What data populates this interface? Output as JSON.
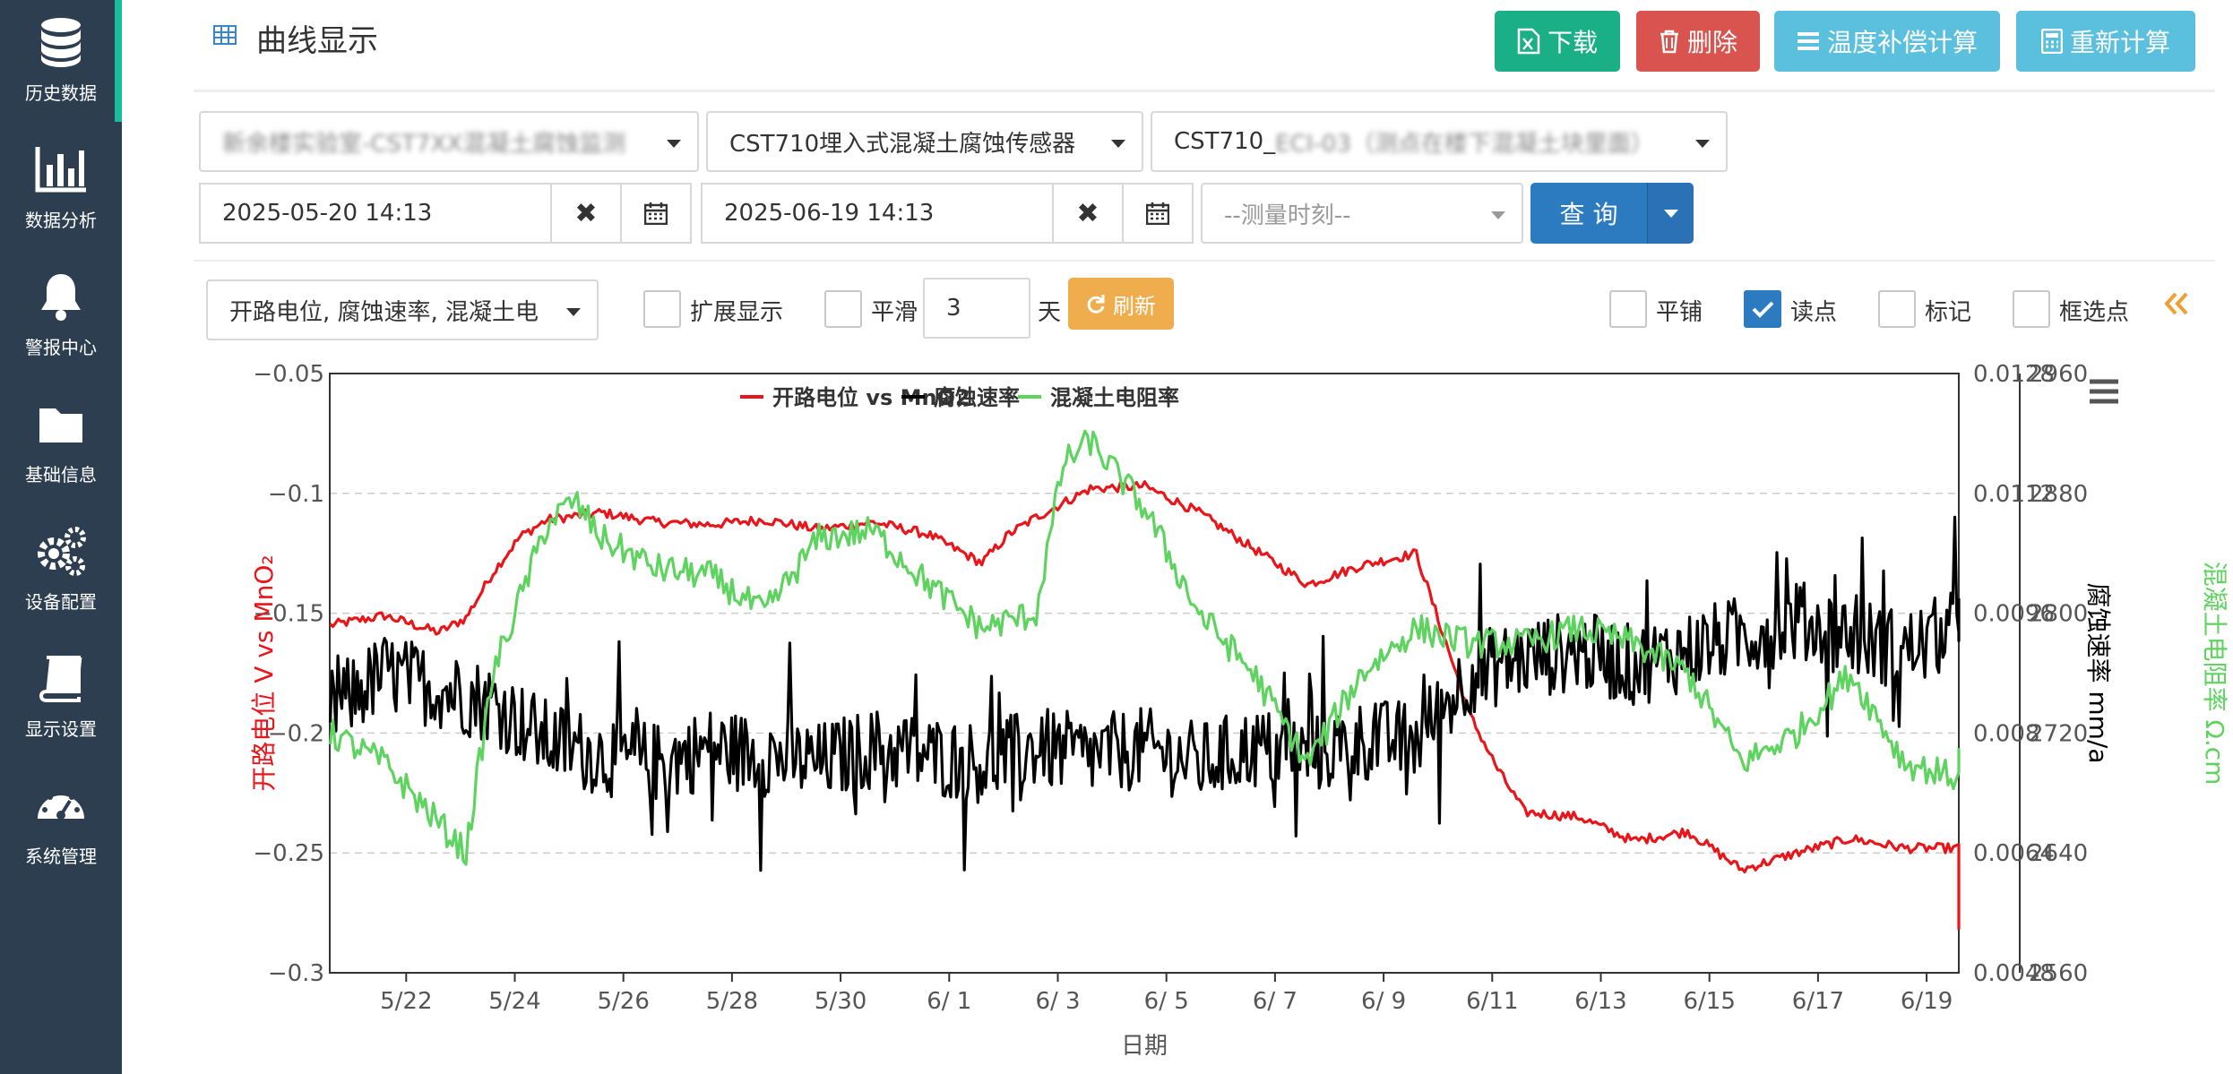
{
  "sidebar": {
    "items": [
      {
        "label": "历史数据",
        "icon": "database-icon",
        "active": true
      },
      {
        "label": "数据分析",
        "icon": "bar-chart-icon",
        "active": false
      },
      {
        "label": "警报中心",
        "icon": "bell-icon",
        "active": false
      },
      {
        "label": "基础信息",
        "icon": "folder-icon",
        "active": false
      },
      {
        "label": "设备配置",
        "icon": "gears-icon",
        "active": false
      },
      {
        "label": "显示设置",
        "icon": "book-icon",
        "active": false
      },
      {
        "label": "系统管理",
        "icon": "dashboard-icon",
        "active": false
      }
    ]
  },
  "header": {
    "title": "曲线显示",
    "buttons": {
      "download": "下载",
      "delete": "删除",
      "temp_comp": "温度补偿计算",
      "recalc": "重新计算"
    }
  },
  "filters": {
    "site": "新余楼实验室-CST7XX混凝土腐蚀监测",
    "sensor_type": "CST710埋入式混凝土腐蚀传感器",
    "sensor_id_prefix": "CST710_",
    "sensor_id_rest": "ECI-03（测点在楼下混凝土块里面）",
    "start_date": "2025-05-20 14:13",
    "end_date": "2025-06-19 14:13",
    "time_placeholder": "--测量时刻--",
    "query_label": "查 询"
  },
  "options": {
    "series_select": "开路电位, 腐蚀速率, 混凝土电",
    "extend_label": "扩展显示",
    "smooth_label": "平滑",
    "smooth_value": "3",
    "days_label": "天",
    "refresh_label": "刷新",
    "tile_label": "平铺",
    "read_point_label": "读点",
    "read_point_checked": true,
    "mark_label": "标记",
    "box_select_label": "框选点"
  },
  "colors": {
    "sidebar_bg": "#2c3e50",
    "accent_teal": "#1abc9c",
    "download": "#1aaf87",
    "delete": "#d9534f",
    "info": "#5bc0de",
    "primary": "#2c7bc0",
    "warning": "#f0ad4e",
    "series_potential": "#e8161b",
    "series_rate": "#000000",
    "series_resistivity": "#5fd35f"
  },
  "chart_data": {
    "type": "line",
    "xlabel": "日期",
    "x_ticks": [
      "5/22",
      "5/24",
      "5/26",
      "5/28",
      "5/30",
      "6/ 1",
      "6/ 3",
      "6/ 5",
      "6/ 7",
      "6/ 9",
      "6/11",
      "6/13",
      "6/15",
      "6/17",
      "6/19"
    ],
    "legend_placement": "top-center",
    "grid": true,
    "axes": {
      "left": {
        "label": "开路电位 V vs MnO₂",
        "min": -0.3,
        "max": -0.05,
        "ticks": [
          "−0.05",
          "−0.1",
          "−0.15",
          "−0.2",
          "−0.25",
          "−0.3"
        ]
      },
      "right1": {
        "label": "腐蚀速率 mm/a",
        "min": 0.0048,
        "max": 0.0128,
        "ticks": [
          "0.0128",
          "0.0112",
          "0.0096",
          "0.008",
          "0.0064",
          "0.0048"
        ]
      },
      "right2": {
        "label": "混凝土电阻率 Ω.cm",
        "min": 2560,
        "max": 2960,
        "ticks": [
          "2960",
          "2880",
          "2800",
          "2720",
          "2640",
          "2560"
        ]
      }
    },
    "x_range": [
      "2025-05-20 14:13",
      "2025-06-19 14:13"
    ],
    "series": [
      {
        "name": "开路电位 vs MnO2",
        "axis": "left",
        "x": [
          "5/20",
          "5/21",
          "5/22",
          "5/22 12h",
          "5/23",
          "5/23 12h",
          "5/24",
          "5/25",
          "5/26",
          "5/27",
          "5/28",
          "5/29",
          "5/30",
          "5/31",
          "6/1",
          "6/1 12h",
          "6/2",
          "6/3",
          "6/4",
          "6/5",
          "6/6",
          "6/7",
          "6/8",
          "6/9",
          "6/10",
          "6/10 12h",
          "6/11",
          "6/12",
          "6/13",
          "6/14",
          "6/15",
          "6/16",
          "6/17",
          "6/18",
          "6/19",
          "6/19 12h"
        ],
        "values": [
          -0.155,
          -0.151,
          -0.158,
          -0.152,
          -0.133,
          -0.118,
          -0.111,
          -0.108,
          -0.112,
          -0.113,
          -0.111,
          -0.115,
          -0.112,
          -0.117,
          -0.129,
          -0.117,
          -0.11,
          -0.098,
          -0.097,
          -0.108,
          -0.123,
          -0.138,
          -0.13,
          -0.125,
          -0.193,
          -0.215,
          -0.233,
          -0.235,
          -0.245,
          -0.241,
          -0.257,
          -0.25,
          -0.244,
          -0.248,
          -0.248,
          -0.282
        ]
      },
      {
        "name": "腐蚀速率",
        "axis": "right1",
        "x": [
          "5/20",
          "5/21",
          "5/22",
          "5/23",
          "5/24",
          "5/25",
          "5/26",
          "5/27",
          "5/28",
          "5/29",
          "5/30",
          "5/31",
          "6/1",
          "6/2",
          "6/3",
          "6/4",
          "6/5",
          "6/6",
          "6/7",
          "6/8",
          "6/9",
          "6/10",
          "6/11",
          "6/12",
          "6/13",
          "6/14",
          "6/15",
          "6/16",
          "6/17",
          "6/18",
          "6/19",
          "6/19 12h"
        ],
        "values": [
          0.0083,
          0.0088,
          0.0086,
          0.0084,
          0.0079,
          0.0077,
          0.0076,
          0.0078,
          0.0077,
          0.0076,
          0.0078,
          0.0077,
          0.0076,
          0.0078,
          0.0077,
          0.0078,
          0.0076,
          0.0078,
          0.0077,
          0.0079,
          0.0079,
          0.0088,
          0.009,
          0.0091,
          0.0089,
          0.0091,
          0.0093,
          0.0095,
          0.0093,
          0.0091,
          0.0094,
          0.0098
        ]
      },
      {
        "name": "混凝土电阻率",
        "axis": "right2",
        "x": [
          "5/20",
          "5/21",
          "5/22",
          "5/22 12h",
          "5/23",
          "5/24",
          "5/24 12h",
          "5/25",
          "5/26",
          "5/27",
          "5/28",
          "5/29",
          "5/30",
          "5/31",
          "6/1",
          "6/2",
          "6/2 12h",
          "6/3",
          "6/4",
          "6/5",
          "6/6",
          "6/7",
          "6/8",
          "6/9",
          "6/10",
          "6/11",
          "6/12",
          "6/13",
          "6/14",
          "6/15",
          "6/16",
          "6/17",
          "6/18",
          "6/19",
          "6/19 12h"
        ],
        "values": [
          2720,
          2700,
          2660,
          2640,
          2760,
          2860,
          2875,
          2850,
          2830,
          2825,
          2800,
          2850,
          2855,
          2820,
          2790,
          2800,
          2900,
          2915,
          2870,
          2800,
          2760,
          2700,
          2760,
          2790,
          2780,
          2780,
          2790,
          2780,
          2760,
          2700,
          2720,
          2760,
          2700,
          2690,
          2710
        ]
      }
    ]
  }
}
